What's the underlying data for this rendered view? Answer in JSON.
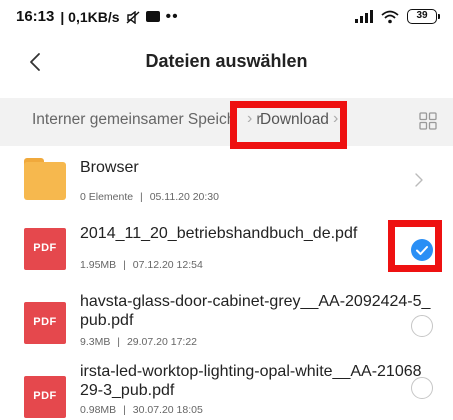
{
  "status_bar": {
    "time": "16:13",
    "speed": "| 0,1KB/s",
    "dots": "••",
    "battery": "39"
  },
  "header": {
    "title": "Dateien auswählen"
  },
  "breadcrumb": {
    "root": "Interner gemeinsamer Speich",
    "root_tail": "r",
    "current": "Download"
  },
  "files": [
    {
      "name": "Browser",
      "meta_left": "0 Elemente",
      "meta_right": "05.11.20 20:30",
      "type": "folder"
    },
    {
      "name": "2014_11_20_betriebshandbuch_de.pdf",
      "meta_left": "1.95MB",
      "meta_right": "07.12.20 12:54",
      "type": "pdf",
      "checked": true,
      "icon_label": "PDF"
    },
    {
      "name_line1": "havsta-glass-door-cabinet-grey__AA-2092424-5_",
      "name_line2": "pub.pdf",
      "meta_left": "9.3MB",
      "meta_right": "29.07.20 17:22",
      "type": "pdf",
      "checked": false,
      "icon_label": "PDF"
    },
    {
      "name_line1": "irsta-led-worktop-lighting-opal-white__AA-21068",
      "name_line2": "29-3_pub.pdf",
      "meta_left": "0.98MB",
      "meta_right": "30.07.20 18:05",
      "type": "pdf",
      "checked": false,
      "icon_label": "PDF"
    }
  ],
  "colors": {
    "accent": "#2a8ff5",
    "pdf": "#e5484d",
    "folder": "#f6b84e",
    "highlight": "#ee1111"
  }
}
